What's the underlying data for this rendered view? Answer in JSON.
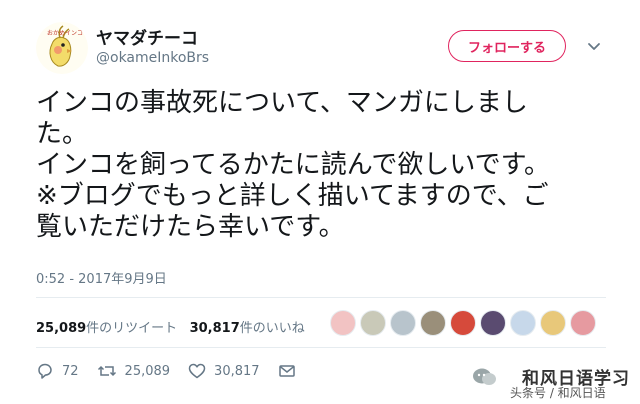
{
  "user": {
    "avatar_text": "おかめインコ",
    "display_name": "ヤマダチーコ",
    "handle": "@okameInkoBrs"
  },
  "follow_button": {
    "label": "フォローする",
    "color": "#e0245e"
  },
  "tweet": {
    "lines": [
      "インコの事故死について、マンガにしまし",
      "た。",
      "インコを飼ってるかたに読んで欲しいです。",
      "※ブログでもっと詳しく描いてますので、ご",
      "覧いただけたら幸いです。"
    ],
    "timestamp": "0:52 - 2017年9月9日"
  },
  "stats": {
    "retweets_count": "25,089",
    "retweets_label": "件のリツイート",
    "likes_count": "30,817",
    "likes_label": "件のいいね"
  },
  "likers": {
    "colors": [
      "#f2c3c3",
      "#c9c9b8",
      "#b8c4cc",
      "#9a8f7a",
      "#d64a3b",
      "#5a4b70",
      "#c7d8ea",
      "#e8c87a",
      "#e69aa0"
    ]
  },
  "actions": {
    "reply_count": "72",
    "retweet_count": "25,089",
    "like_count": "30,817"
  },
  "watermark": {
    "title": "和风日语学习",
    "subtitle": "头条号 / 和风日语"
  }
}
